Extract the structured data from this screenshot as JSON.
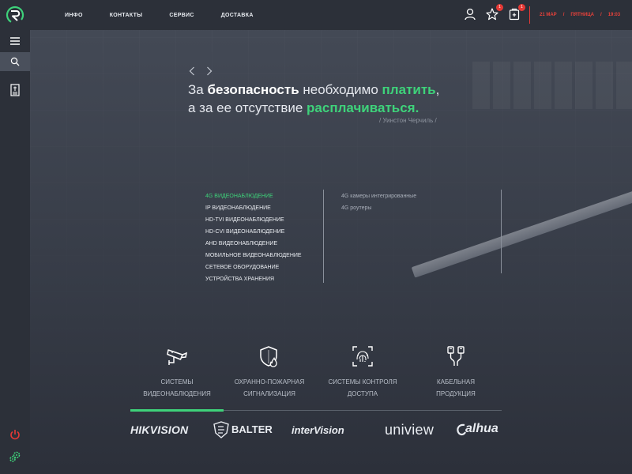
{
  "nav": {
    "items": [
      "ИНФО",
      "КОНТАКТЫ",
      "СЕРВИС",
      "ДОСТАВКА"
    ]
  },
  "header": {
    "icons": [
      "user-icon",
      "star-icon",
      "cart-icon"
    ],
    "favorites_badge": "1",
    "cart_badge": "1",
    "date": "21 МАР",
    "separator": "/",
    "weekday": "ПЯТНИЦА",
    "time": "19:03"
  },
  "sidebar": {
    "icons": [
      "menu-icon",
      "search-icon",
      "document-icon",
      "power-icon",
      "gears-icon"
    ]
  },
  "quote": {
    "line1_a": "За ",
    "line1_b": "безопасность",
    "line1_c": " необходимо ",
    "line1_d": "платить",
    "line1_e": ",",
    "line2_a": "а за ее отсутствие ",
    "line2_b": "расплачиваться.",
    "author": "/ Уинстон Черчиль /"
  },
  "menu": {
    "left": [
      "4G ВИДЕОНАБЛЮДЕНИЕ",
      "IP ВИДЕОНАБЛЮДЕНИЕ",
      "HD-TVI ВИДЕОНАБЛЮДЕНИЕ",
      "HD-CVI ВИДЕОНАБЛЮДЕНИЕ",
      "AHD ВИДЕОНАБЛЮДЕНИЕ",
      "МОБИЛЬНОЕ ВИДЕОНАБЛЮДЕНИЕ",
      "СЕТЕВОЕ ОБОРУДОВАНИЕ",
      "УСТРОЙСТВА ХРАНЕНИЯ"
    ],
    "right": [
      "4G камеры интегрированные",
      "4G роутеры"
    ]
  },
  "categories": [
    {
      "label": "СИСТЕМЫ\nВИДЕОНАБЛЮДЕНИЯ",
      "icon": "cctv-camera-icon"
    },
    {
      "label": "ОХРАННО-ПОЖАРНАЯ\nСИГНАЛИЗАЦИЯ",
      "icon": "shield-fire-icon"
    },
    {
      "label": "СИСТЕМЫ КОНТРОЛЯ\nДОСТУПА",
      "icon": "fingerprint-icon"
    },
    {
      "label": "КАБЕЛЬНАЯ\nПРОДУКЦИЯ",
      "icon": "cable-connector-icon"
    }
  ],
  "brands": [
    "HIKVISION",
    "BALTER",
    "interVision",
    "uniview",
    "alhua"
  ],
  "colors": {
    "accent": "#3ed27a",
    "alert": "#e5413a",
    "bar": "#2c3039"
  }
}
